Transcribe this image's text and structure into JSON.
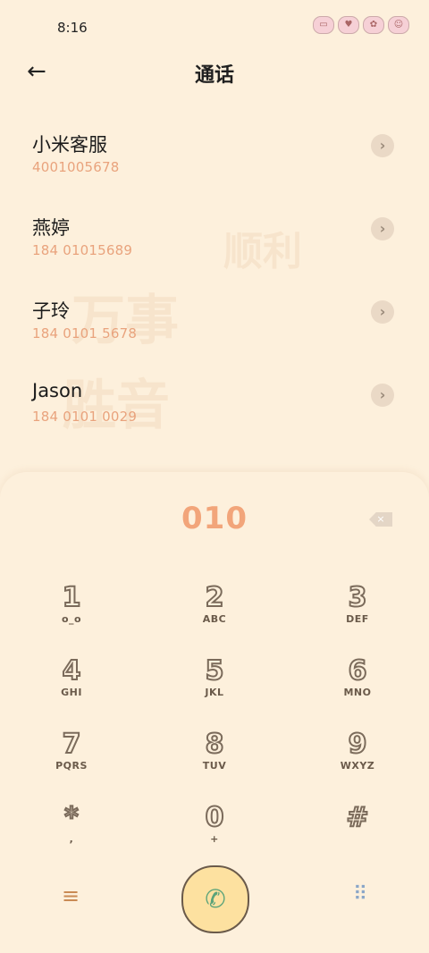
{
  "status_bar": {
    "time": "8:16"
  },
  "header": {
    "title": "通话"
  },
  "contacts": [
    {
      "name": "小米客服",
      "number": "4001005678"
    },
    {
      "name": "燕婷",
      "number": "184 01015689"
    },
    {
      "name": "子玲",
      "number": "184 0101 5678"
    },
    {
      "name": "Jason",
      "number": "184 0101 0029"
    }
  ],
  "dialpad": {
    "input_value": "010",
    "keys": [
      {
        "digit": "1",
        "letters": "o_o"
      },
      {
        "digit": "2",
        "letters": "ABC"
      },
      {
        "digit": "3",
        "letters": "DEF"
      },
      {
        "digit": "4",
        "letters": "GHI"
      },
      {
        "digit": "5",
        "letters": "JKL"
      },
      {
        "digit": "6",
        "letters": "MNO"
      },
      {
        "digit": "7",
        "letters": "PQRS"
      },
      {
        "digit": "8",
        "letters": "TUV"
      },
      {
        "digit": "9",
        "letters": "WXYZ"
      },
      {
        "digit": "*",
        "letters": ","
      },
      {
        "digit": "0",
        "letters": "+"
      },
      {
        "digit": "#",
        "letters": ""
      }
    ]
  },
  "icons": {
    "back": "arrow-left-icon",
    "chevron": "chevron-right-icon",
    "backspace": "backspace-icon",
    "call": "phone-icon",
    "menu": "menu-icon",
    "keypad": "keypad-icon"
  },
  "colors": {
    "background": "#fdf0dc",
    "number_accent": "#e9a37d",
    "input_accent": "#f2a57a"
  }
}
